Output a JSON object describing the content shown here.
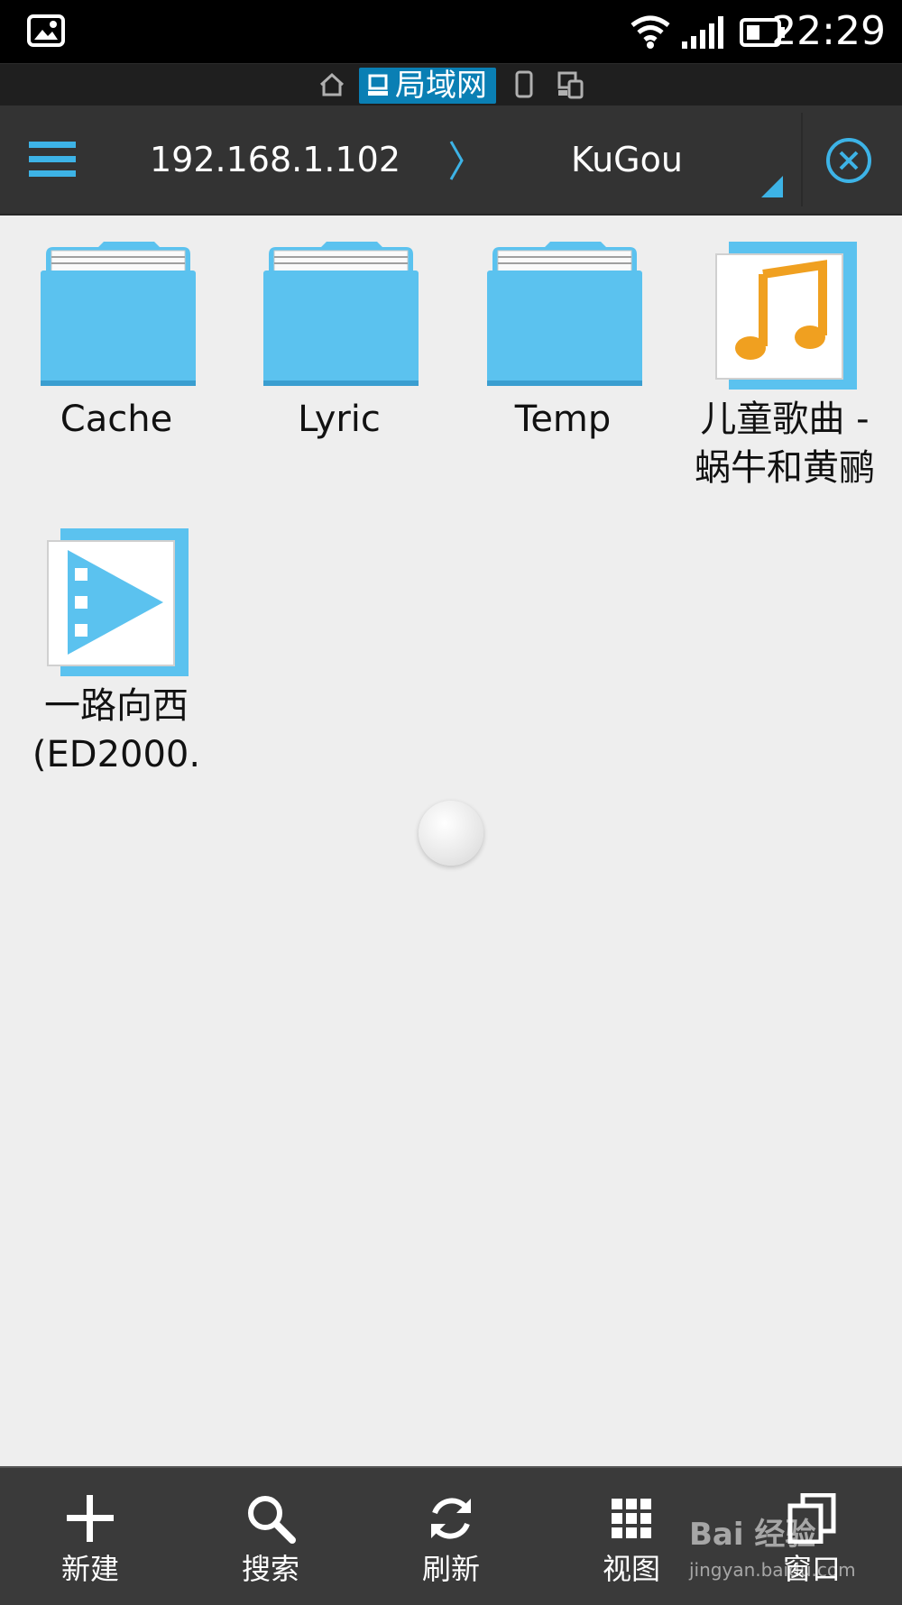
{
  "status_bar": {
    "time": "22:29",
    "icons": [
      "image-notification-icon",
      "wifi-icon",
      "signal-icon",
      "battery-icon"
    ]
  },
  "location_tabs": {
    "items": [
      {
        "icon": "home-icon",
        "label": ""
      },
      {
        "icon": "computer-icon",
        "label": "局域网",
        "selected": true
      },
      {
        "icon": "phone-icon",
        "label": ""
      },
      {
        "icon": "devices-icon",
        "label": ""
      }
    ]
  },
  "toolbar": {
    "menu_icon": "hamburger-menu-icon",
    "breadcrumb": [
      "192.168.1.102",
      "KuGou"
    ],
    "close_icon": "close-circle-icon"
  },
  "files": [
    {
      "name": "Cache",
      "type": "folder"
    },
    {
      "name": "Lyric",
      "type": "folder"
    },
    {
      "name": "Temp",
      "type": "folder"
    },
    {
      "name": "儿童歌曲 -",
      "name_line2": "蜗牛和黄鹂",
      "type": "audio"
    },
    {
      "name": "一路向西",
      "name_line2": "(ED2000.",
      "type": "video"
    }
  ],
  "bottom_bar": {
    "new_label": "新建",
    "search_label": "搜索",
    "refresh_label": "刷新",
    "view_label": "视图",
    "window_label": "窗口"
  },
  "watermark": {
    "logo_text": "Bai 经验",
    "url": "jingyan.baidu.com"
  },
  "colors": {
    "accent": "#3db3e6",
    "folder": "#5bc2ef",
    "lan_tab": "#0a7fb4",
    "music_note": "#f0a020",
    "background": "#eeeeee",
    "toolbar": "#333333"
  }
}
